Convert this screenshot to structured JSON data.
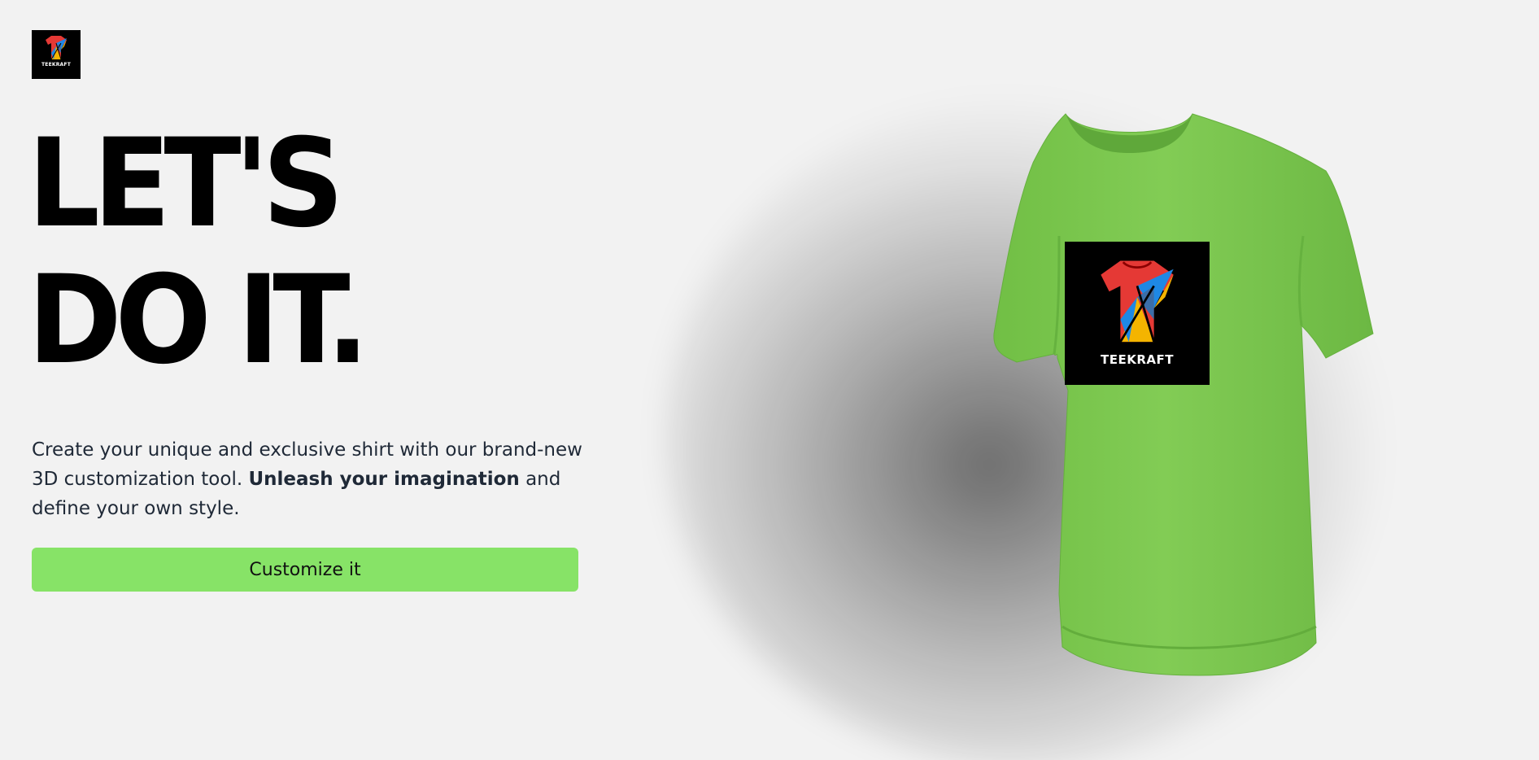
{
  "brand": {
    "logo_text": "TEEKRAFT",
    "print_text": "TEEKRAFT",
    "logo_icon": "tshirt-mosaic-icon"
  },
  "hero": {
    "headline_line1": "LET'S",
    "headline_line2": "DO IT.",
    "desc_part1": "Create your unique and exclusive shirt with our brand-new 3D customization tool. ",
    "desc_bold": "Unleash your imagination",
    "desc_part2": " and define your own style.",
    "cta_label": "Customize it"
  },
  "colors": {
    "background": "#f2f2f2",
    "shirt": "#7cc94f",
    "button": "#87e367",
    "headline": "#000000",
    "body_text": "#1f2937"
  }
}
